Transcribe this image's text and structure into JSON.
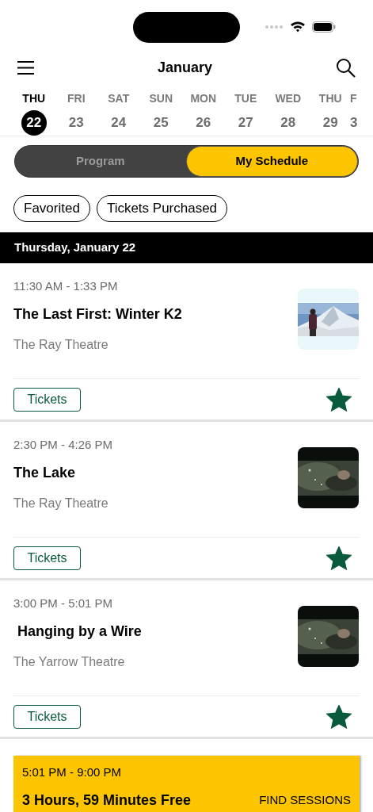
{
  "header": {
    "title": "January"
  },
  "days": [
    {
      "weekday": "THU",
      "date": "22",
      "selected": true
    },
    {
      "weekday": "FRI",
      "date": "23",
      "selected": false
    },
    {
      "weekday": "SAT",
      "date": "24",
      "selected": false
    },
    {
      "weekday": "SUN",
      "date": "25",
      "selected": false
    },
    {
      "weekday": "MON",
      "date": "26",
      "selected": false
    },
    {
      "weekday": "TUE",
      "date": "27",
      "selected": false
    },
    {
      "weekday": "WED",
      "date": "28",
      "selected": false
    },
    {
      "weekday": "THU",
      "date": "29",
      "selected": false
    },
    {
      "weekday": "F",
      "date": "3",
      "selected": false
    }
  ],
  "segments": [
    {
      "label": "Program",
      "selected": false
    },
    {
      "label": "My Schedule",
      "selected": true
    }
  ],
  "filters": [
    {
      "label": "Favorited",
      "selected": false
    },
    {
      "label": "Tickets Purchased",
      "selected": false
    }
  ],
  "day_heading": "Thursday, January 22",
  "events": [
    {
      "time": "11:30 AM - 1:33 PM",
      "title": "The Last First: Winter K2",
      "venue": "The Ray Theatre",
      "thumbnail": {
        "kind": "picture",
        "dark_frame": false
      },
      "button": "Tickets",
      "favorited": true
    },
    {
      "time": "2:30 PM - 4:26 PM",
      "title": "The Lake",
      "venue": "The Ray Theatre",
      "thumbnail": {
        "kind": "picture",
        "dark_frame": true
      },
      "button": "Tickets",
      "favorited": true
    },
    {
      "time": "3:00 PM - 5:01 PM",
      "title": " Hanging by a Wire",
      "venue": "The Yarrow Theatre",
      "thumbnail": {
        "kind": "picture",
        "dark_frame": true
      },
      "button": "Tickets",
      "favorited": true
    }
  ],
  "free_slot": {
    "time": "5:01 PM - 9:00 PM",
    "title": "3 Hours, 59 Minutes Free",
    "action": "FIND SESSIONS"
  }
}
